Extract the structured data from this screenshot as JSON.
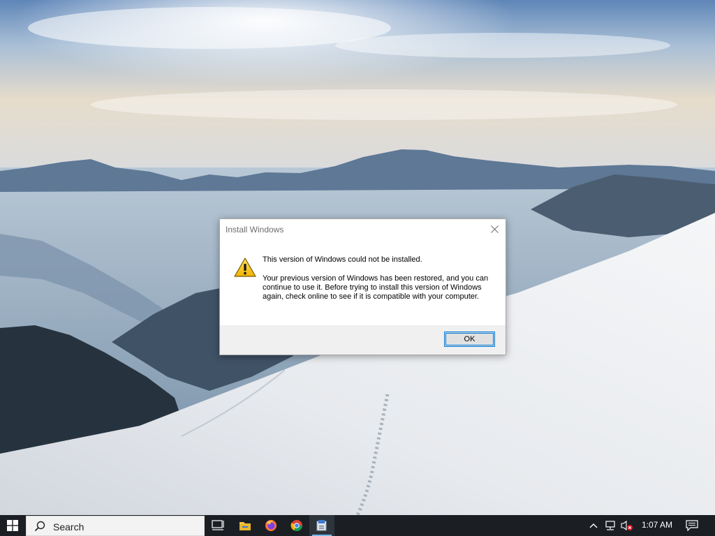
{
  "dialog": {
    "title": "Install Windows",
    "heading": "This version of Windows could not be installed.",
    "body": "Your previous version of Windows has been restored, and you can continue to use it.  Before trying to install this version of Windows again, check online to see if it is compatible with your computer.",
    "ok_label": "OK",
    "icons": {
      "warning": "warning-icon",
      "close": "close-icon"
    }
  },
  "taskbar": {
    "search_placeholder": "Search",
    "apps": [
      "task-view-icon",
      "file-explorer-icon",
      "firefox-icon",
      "chrome-icon",
      "installer-icon"
    ],
    "active_app": "installer-icon",
    "tray": [
      "chevron-up-icon",
      "network-icon",
      "volume-muted-icon"
    ],
    "clock": "1:07 AM",
    "notification_icon": "action-center-icon",
    "colors": {
      "bar": "#1b1f24",
      "accent": "#76b9ed"
    }
  },
  "colors": {
    "dialog_footer": "#f0f0f0",
    "button_border": "#0078d7"
  }
}
